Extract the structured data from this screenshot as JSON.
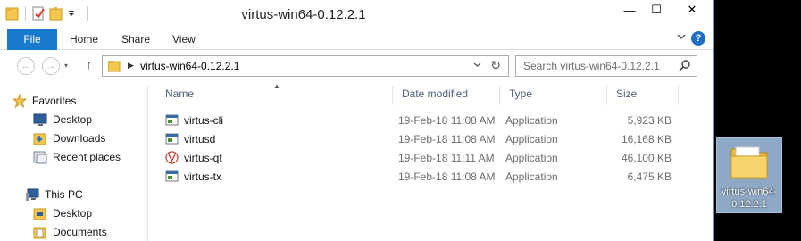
{
  "window": {
    "title": "virtus-win64-0.12.2.1",
    "controls": {
      "minimize": "—",
      "maximize": "☐",
      "close": "✕"
    }
  },
  "ribbon": {
    "tabs": [
      {
        "label": "File"
      },
      {
        "label": "Home"
      },
      {
        "label": "Share"
      },
      {
        "label": "View"
      }
    ],
    "help_label": "?"
  },
  "navigation": {
    "back_icon": "←",
    "forward_icon": "→",
    "up_icon": "↑",
    "address_path": "virtus-win64-0.12.2.1",
    "refresh_icon": "↻",
    "search_placeholder": "Search virtus-win64-0.12.2.1"
  },
  "nav_pane": {
    "favorites_label": "Favorites",
    "favorites": [
      {
        "label": "Desktop",
        "icon": "desktop-icon"
      },
      {
        "label": "Downloads",
        "icon": "downloads-icon"
      },
      {
        "label": "Recent places",
        "icon": "recent-places-icon"
      }
    ],
    "this_pc_label": "This PC",
    "this_pc": [
      {
        "label": "Desktop",
        "icon": "desktop-folder-icon"
      },
      {
        "label": "Documents",
        "icon": "documents-folder-icon"
      }
    ]
  },
  "file_list": {
    "columns": [
      "Name",
      "Date modified",
      "Type",
      "Size"
    ],
    "rows": [
      {
        "name": "virtus-cli",
        "date": "19-Feb-18 11:08 AM",
        "type": "Application",
        "size": "5,923 KB",
        "icon": "app-icon"
      },
      {
        "name": "virtusd",
        "date": "19-Feb-18 11:08 AM",
        "type": "Application",
        "size": "16,168 KB",
        "icon": "app-icon"
      },
      {
        "name": "virtus-qt",
        "date": "19-Feb-18 11:11 AM",
        "type": "Application",
        "size": "46,100 KB",
        "icon": "virtus-logo-icon"
      },
      {
        "name": "virtus-tx",
        "date": "19-Feb-18 11:08 AM",
        "type": "Application",
        "size": "6,475 KB",
        "icon": "app-icon"
      }
    ]
  },
  "desktop": {
    "folder_label_line1": "virtus-win64-",
    "folder_label_line2": "0.12.2.1"
  },
  "colors": {
    "file_tab": "#1979ca",
    "folder_yellow": "#f3c74d",
    "header_text": "#4c607a",
    "desktop_selection": "#8ea9c6"
  }
}
